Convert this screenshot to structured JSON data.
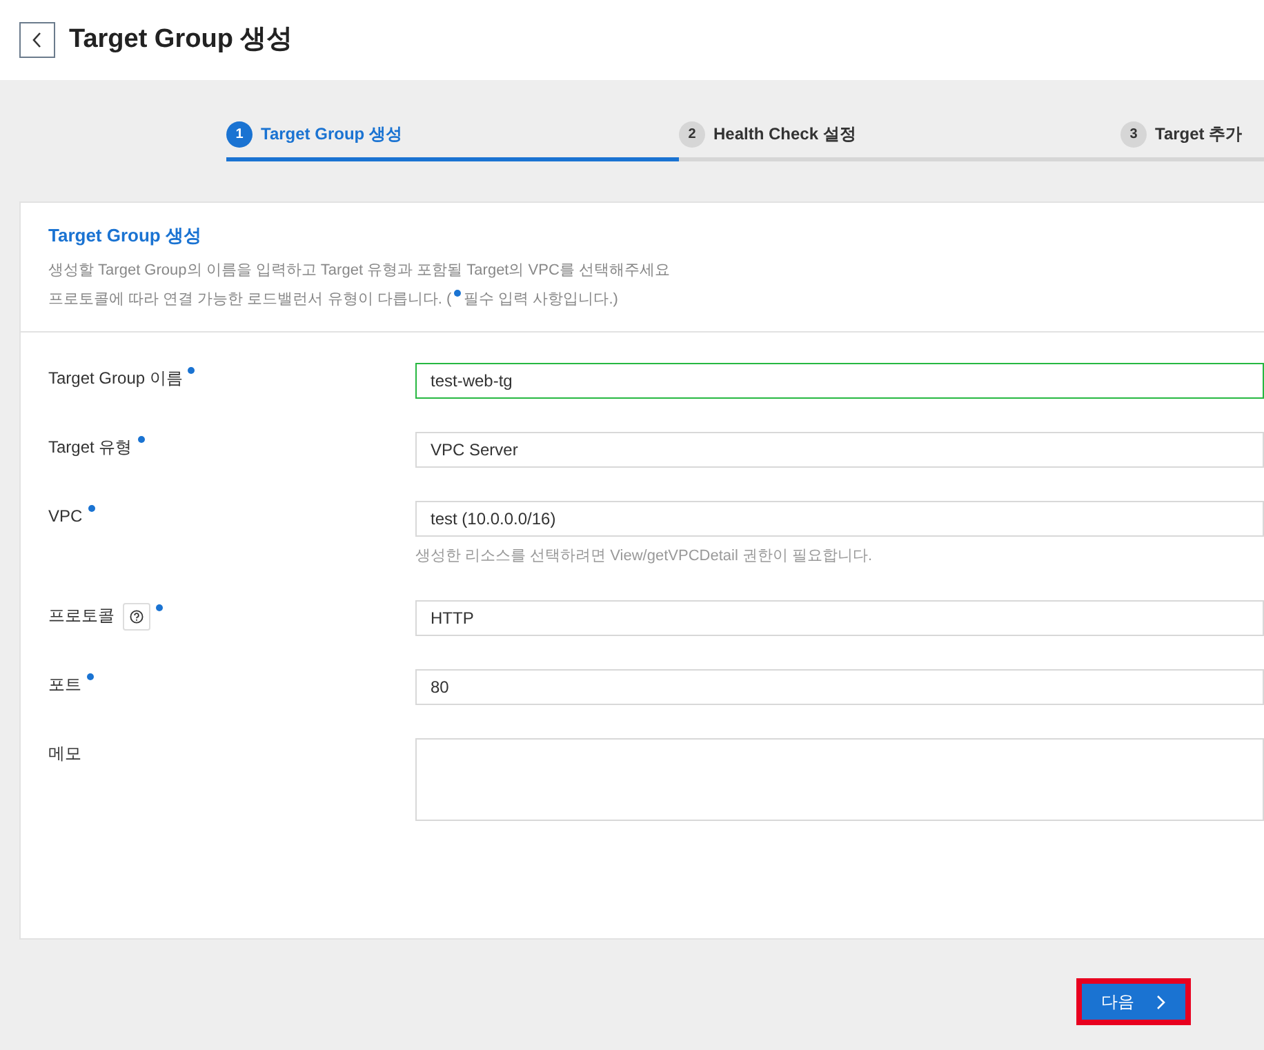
{
  "header": {
    "title": "Target Group 생성"
  },
  "steps": [
    {
      "number": "1",
      "label": "Target Group 생성",
      "selected": true
    },
    {
      "number": "2",
      "label": "Health Check 설정",
      "selected": false
    },
    {
      "number": "3",
      "label": "Target 추가",
      "selected": false
    }
  ],
  "card": {
    "title": "Target Group 생성",
    "description": "생성할 Target Group의 이름을 입력하고 Target 유형과 포함될 Target의 VPC를 선택해주세요",
    "note_before": "프로토콜에 따라 연결 가능한 로드밸런서 유형이 다릅니다. (",
    "note_after": "필수 입력 사항입니다.)"
  },
  "fields": [
    {
      "label": "Target Group 이름",
      "kind": "input",
      "value": "test-web-tg",
      "required": true,
      "focused": true,
      "help": false
    },
    {
      "label": "Target 유형",
      "kind": "select",
      "value": "VPC Server",
      "required": true,
      "focused": false,
      "help": false
    },
    {
      "label": "VPC",
      "kind": "select",
      "value": "test (10.0.0.0/16)",
      "required": true,
      "focused": false,
      "help": false,
      "hint": "생성한 리소스를 선택하려면 View/getVPCDetail 권한이 필요합니다."
    },
    {
      "label": "프로토콜",
      "kind": "select",
      "value": "HTTP",
      "required": true,
      "focused": false,
      "help": true
    },
    {
      "label": "포트",
      "kind": "input",
      "value": "80",
      "required": true,
      "focused": false,
      "help": false
    },
    {
      "label": "메모",
      "kind": "textarea",
      "required": false,
      "focused": false,
      "help": false
    }
  ],
  "next_button": {
    "label": "다음",
    "highlighted": true
  }
}
